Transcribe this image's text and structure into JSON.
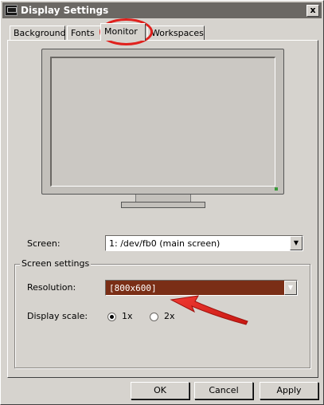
{
  "window": {
    "title": "Display Settings",
    "close_glyph": "x"
  },
  "tabs": [
    {
      "label": "Background"
    },
    {
      "label": "Fonts"
    },
    {
      "label": "Monitor",
      "active": true
    },
    {
      "label": "Workspaces"
    }
  ],
  "screen": {
    "label": "Screen:",
    "value": "1: /dev/fb0 (main screen)"
  },
  "group": {
    "title": "Screen settings",
    "resolution_label": "Resolution:",
    "resolution_value": "[800x600]",
    "scale_label": "Display scale:",
    "scale_options": [
      "1x",
      "2x"
    ],
    "scale_selected": "1x"
  },
  "buttons": {
    "ok": "OK",
    "cancel": "Cancel",
    "apply": "Apply"
  },
  "colors": {
    "annotation": "#e0211d",
    "selected_field": "#7a2e16",
    "titlebar": "#6b6864"
  },
  "icons": {
    "window_icon": "monitor-icon",
    "combo_arrow": "chevron-down-icon"
  }
}
